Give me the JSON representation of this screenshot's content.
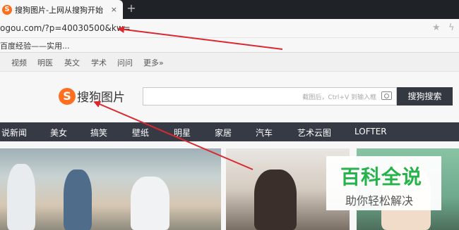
{
  "browser": {
    "tab_title": "搜狗图片-上网从搜狗开始",
    "tab_close": "×",
    "new_tab": "+",
    "address": "ogou.com/?p=40030500&kw=",
    "bookmark": "百度经验——实用..."
  },
  "topnav": [
    "视频",
    "明医",
    "英文",
    "学术",
    "问问",
    "更多»"
  ],
  "header": {
    "logo_text": "搜狗图片",
    "search_value": "",
    "search_hint": "截图后，Ctrl+V 到输入框",
    "search_button": "搜狗搜索"
  },
  "categories": [
    "说新闻",
    "美女",
    "搞笑",
    "壁纸",
    "明星",
    "家居",
    "汽车",
    "艺术云图",
    "LOFTER"
  ],
  "watermark": {
    "title": "百科全说",
    "subtitle": "助你轻松解决"
  },
  "colors": {
    "annotation_arrow": "#d9282f",
    "logo_orange": "#ff6f1f",
    "category_bar": "#353a44",
    "watermark_green": "#26b34b"
  }
}
